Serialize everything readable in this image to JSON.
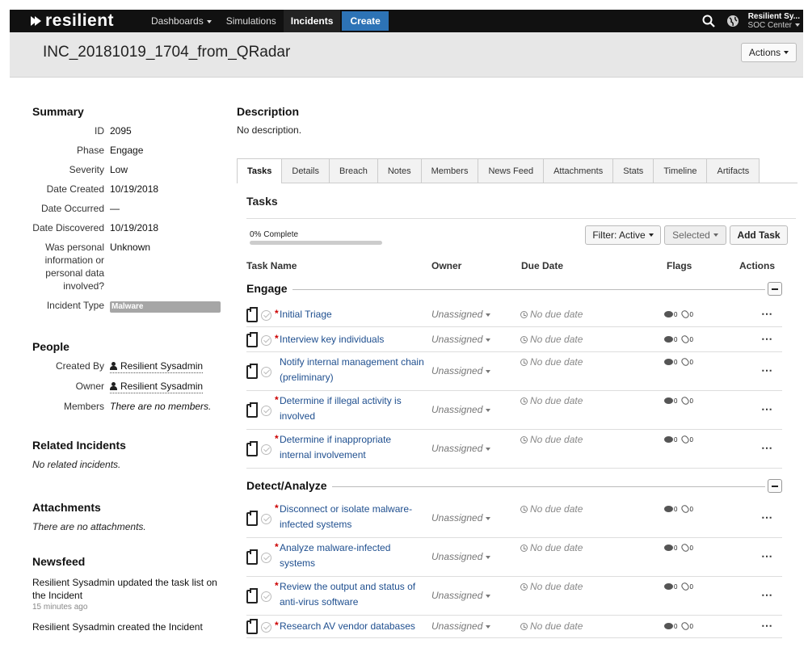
{
  "nav": {
    "logo": "resilient",
    "items": [
      {
        "label": "Dashboards",
        "dropdown": true
      },
      {
        "label": "Simulations",
        "dropdown": false
      },
      {
        "label": "Incidents",
        "dropdown": false
      }
    ],
    "create_label": "Create",
    "user_name": "Resilient Sy...",
    "org_name": "SOC Center"
  },
  "header": {
    "title": "INC_20181019_1704_from_QRadar",
    "actions_label": "Actions"
  },
  "summary": {
    "heading": "Summary",
    "fields": [
      {
        "key": "ID",
        "value": "2095"
      },
      {
        "key": "Phase",
        "value": "Engage"
      },
      {
        "key": "Severity",
        "value": "Low"
      },
      {
        "key": "Date Created",
        "value": "10/19/2018"
      },
      {
        "key": "Date Occurred",
        "value": "—"
      },
      {
        "key": "Date Discovered",
        "value": "10/19/2018"
      },
      {
        "key": "Was personal information or personal data involved?",
        "value": "Unknown"
      }
    ],
    "incident_type_key": "Incident Type",
    "incident_type_value": "Malware"
  },
  "people": {
    "heading": "People",
    "created_by_key": "Created By",
    "created_by_value": "Resilient Sysadmin",
    "owner_key": "Owner",
    "owner_value": "Resilient Sysadmin",
    "members_key": "Members",
    "members_value": "There are no members."
  },
  "related": {
    "heading": "Related Incidents",
    "empty": "No related incidents."
  },
  "attachments": {
    "heading": "Attachments",
    "empty": "There are no attachments."
  },
  "newsfeed": {
    "heading": "Newsfeed",
    "items": [
      {
        "text": "Resilient Sysadmin updated the task list on the Incident",
        "time": "15 minutes ago"
      },
      {
        "text": "Resilient Sysadmin created the Incident",
        "time": ""
      }
    ]
  },
  "description": {
    "heading": "Description",
    "text": "No description."
  },
  "tabs": [
    "Tasks",
    "Details",
    "Breach",
    "Notes",
    "Members",
    "News Feed",
    "Attachments",
    "Stats",
    "Timeline",
    "Artifacts"
  ],
  "tasks": {
    "heading": "Tasks",
    "progress_label": "0% Complete",
    "progress_fraction": 0,
    "filter_label": "Filter: Active",
    "selected_label": "Selected",
    "add_label": "Add Task",
    "columns": {
      "name": "Task Name",
      "owner": "Owner",
      "due": "Due Date",
      "flags": "Flags",
      "actions": "Actions"
    },
    "groups": [
      {
        "name": "Engage",
        "tasks": [
          {
            "required": true,
            "name": "Initial Triage",
            "owner": "Unassigned",
            "due": "No due date",
            "comments": "0",
            "attachments": "0"
          },
          {
            "required": true,
            "name": "Interview key individuals",
            "owner": "Unassigned",
            "due": "No due date",
            "comments": "0",
            "attachments": "0"
          },
          {
            "required": false,
            "name": "Notify internal management chain (preliminary)",
            "owner": "Unassigned",
            "due": "No due date",
            "comments": "0",
            "attachments": "0"
          },
          {
            "required": true,
            "name": "Determine if illegal activity is involved",
            "owner": "Unassigned",
            "due": "No due date",
            "comments": "0",
            "attachments": "0"
          },
          {
            "required": true,
            "name": "Determine if inappropriate internal involvement",
            "owner": "Unassigned",
            "due": "No due date",
            "comments": "0",
            "attachments": "0"
          }
        ]
      },
      {
        "name": "Detect/Analyze",
        "tasks": [
          {
            "required": true,
            "name": "Disconnect or isolate malware-infected systems",
            "owner": "Unassigned",
            "due": "No due date",
            "comments": "0",
            "attachments": "0"
          },
          {
            "required": true,
            "name": "Analyze malware-infected systems",
            "owner": "Unassigned",
            "due": "No due date",
            "comments": "0",
            "attachments": "0"
          },
          {
            "required": true,
            "name": "Review the output and status of anti-virus software",
            "owner": "Unassigned",
            "due": "No due date",
            "comments": "0",
            "attachments": "0"
          },
          {
            "required": true,
            "name": "Research AV vendor databases",
            "owner": "Unassigned",
            "due": "No due date",
            "comments": "0",
            "attachments": "0"
          }
        ]
      }
    ]
  },
  "colors": {
    "nav_bg": "#111111",
    "accent": "#2d73b6",
    "link": "#1f4f8f",
    "required": "#cc0000",
    "tag": "#a6a6a6"
  }
}
